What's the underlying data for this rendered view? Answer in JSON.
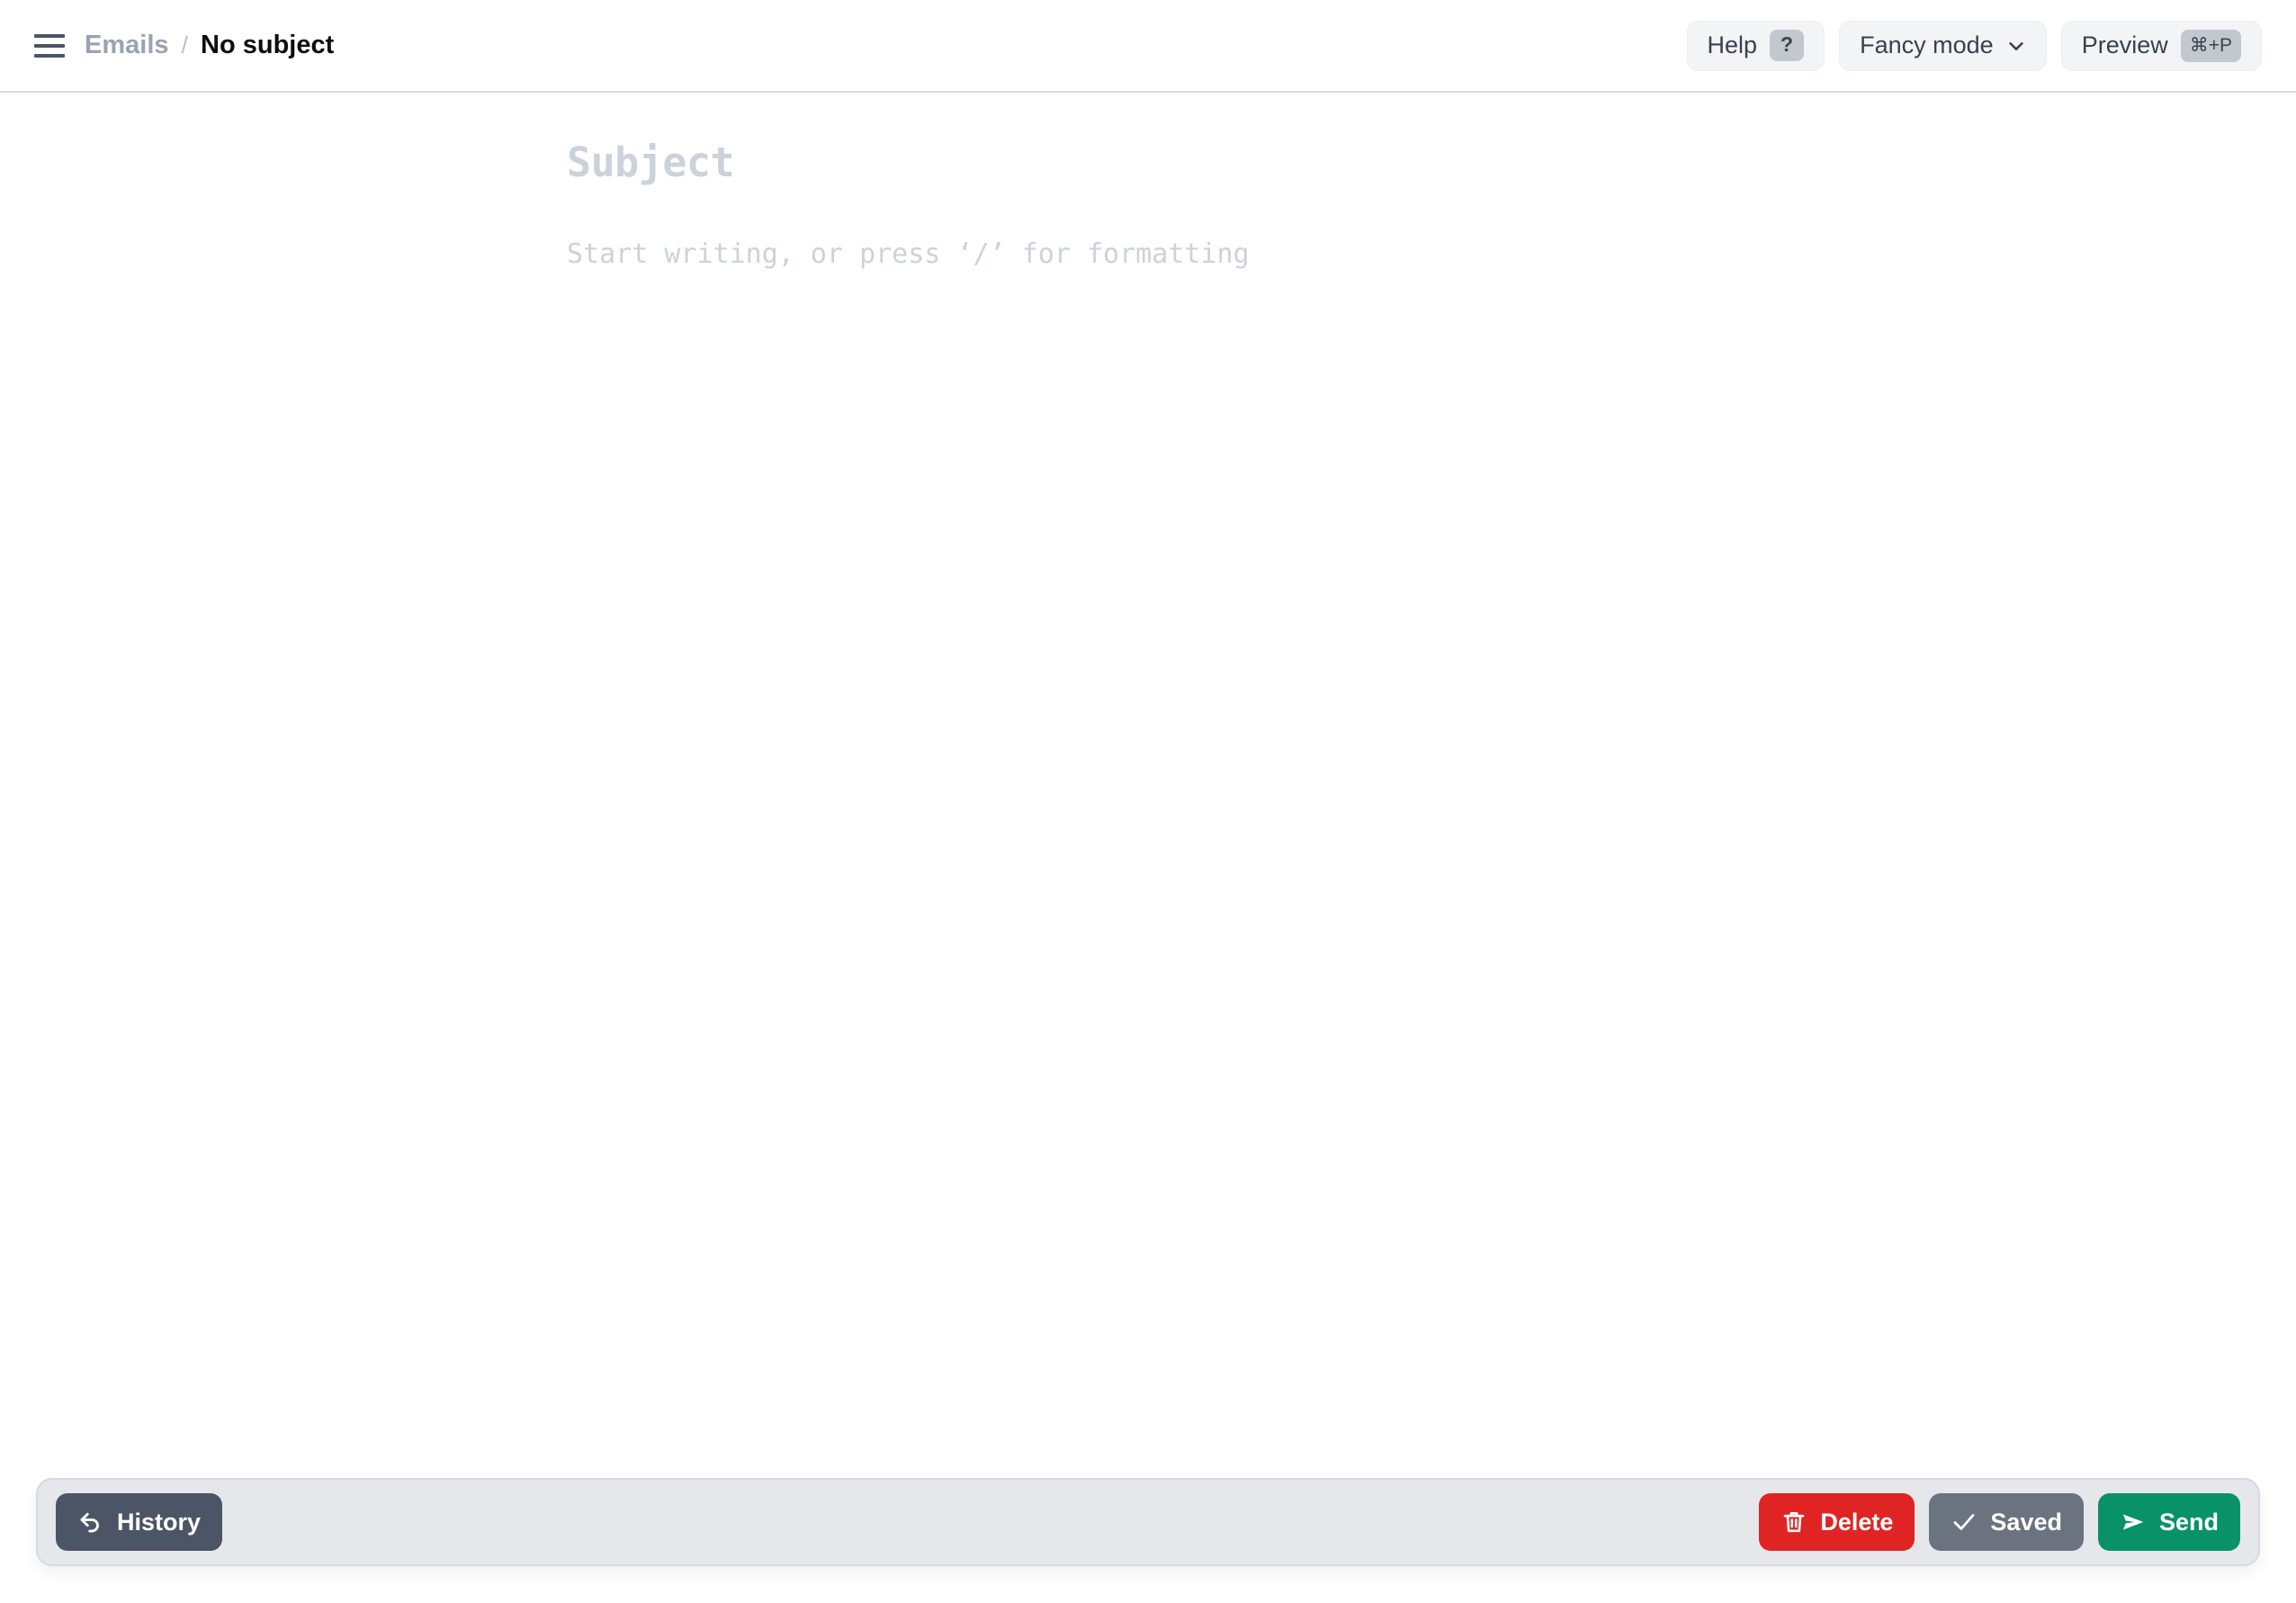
{
  "header": {
    "menu_icon": "hamburger-menu-icon",
    "breadcrumb": {
      "parent": "Emails",
      "separator": "/",
      "current": "No subject"
    },
    "actions": {
      "help_label": "Help",
      "help_shortcut": "?",
      "mode_label": "Fancy mode",
      "mode_chevron": "chevron-down-icon",
      "preview_label": "Preview",
      "preview_shortcut": "⌘+P"
    }
  },
  "editor": {
    "subject_placeholder": "Subject",
    "body_placeholder": "Start writing, or press ‘/’ for formatting"
  },
  "bottombar": {
    "history_label": "History",
    "history_icon": "undo-arrow-icon",
    "delete_label": "Delete",
    "delete_icon": "trash-icon",
    "saved_label": "Saved",
    "saved_icon": "check-icon",
    "send_label": "Send",
    "send_icon": "send-plane-icon"
  },
  "colors": {
    "delete": "#e02424",
    "saved": "#6b7280",
    "send": "#099268",
    "history": "#4b5565",
    "bar_background": "#e5e7eb",
    "placeholder": "#ccd2da",
    "breadcrumb_parent": "#9aa3b2"
  }
}
